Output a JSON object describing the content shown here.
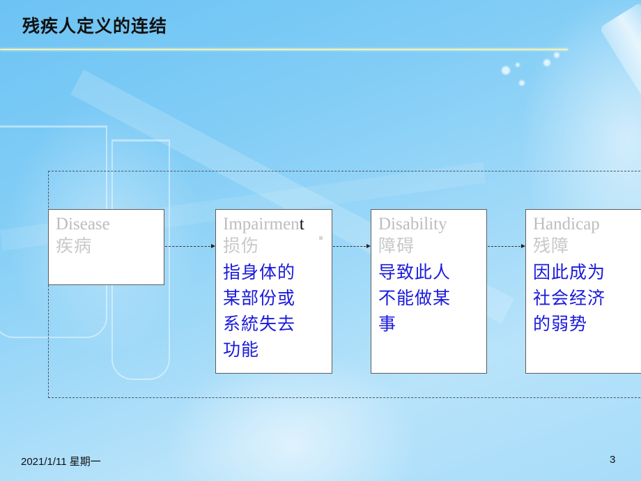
{
  "slide": {
    "title": "残疾人定义的连结",
    "boxes": [
      {
        "english": "Disease",
        "english_last_char": "",
        "chinese": "疾病",
        "description": []
      },
      {
        "english": "Impairmen",
        "english_last_char": "t",
        "chinese": "损伤",
        "description": [
          "指身体的",
          "某部份或",
          "系統失去",
          "功能"
        ]
      },
      {
        "english": "Disability",
        "english_last_char": "",
        "chinese": "障碍",
        "description": [
          "导致此人",
          "不能做某",
          "事"
        ]
      },
      {
        "english": "Handicap",
        "english_last_char": "",
        "chinese": "残障",
        "description": [
          "因此成为",
          "社会经济",
          "的弱势"
        ]
      }
    ],
    "footer": {
      "date": "2021/1/11 星期一",
      "page_number": "3"
    }
  },
  "colors": {
    "label_gray": "#bdbdbd",
    "description_blue": "#1a1adb",
    "divider_yellow": "#f3f1b0",
    "background_blue": "#82cdf6"
  }
}
